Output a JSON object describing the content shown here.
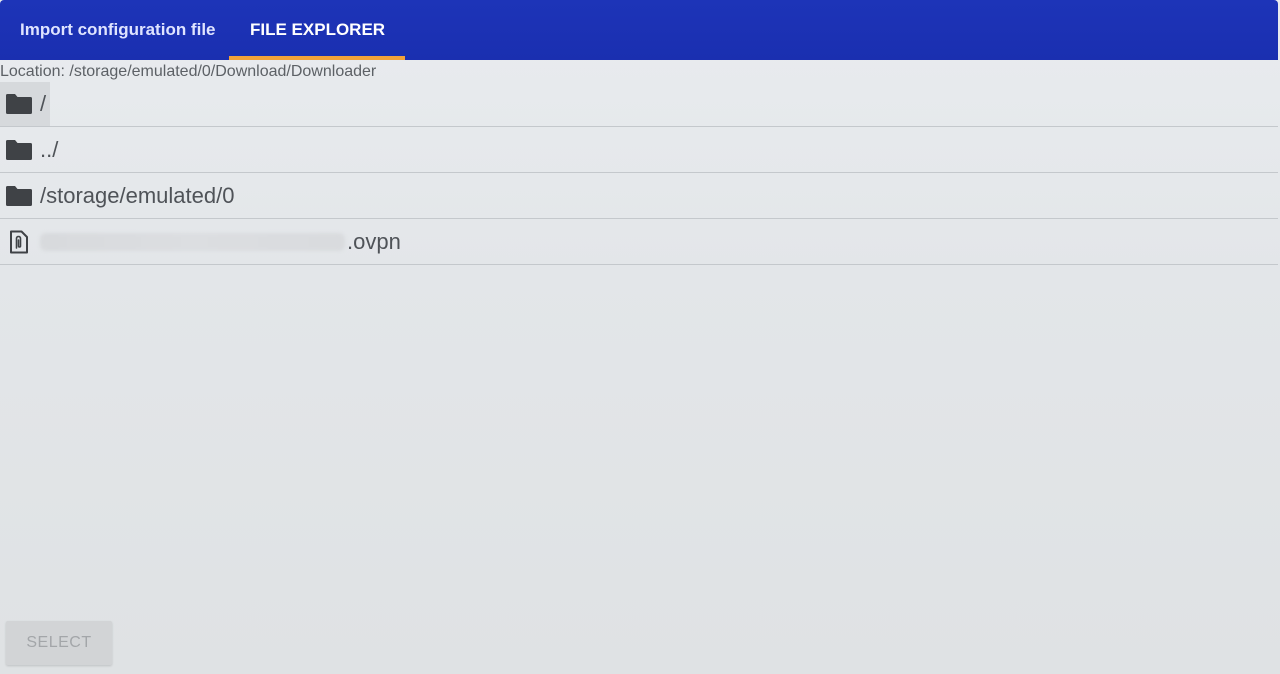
{
  "tabs": {
    "import_label": "Import configuration file",
    "explorer_label": "FILE EXPLORER",
    "indicator_color": "#f2a23a",
    "bar_color": "#1d34b8"
  },
  "location": {
    "text": "Location: /storage/emulated/0/Download/Downloader"
  },
  "file_list": {
    "items": [
      {
        "label": "/",
        "icon": "folder-icon"
      },
      {
        "label": "../",
        "icon": "folder-icon"
      },
      {
        "label": "/storage/emulated/0",
        "icon": "folder-icon"
      },
      {
        "label": ".ovpn",
        "icon": "file-icon"
      }
    ]
  },
  "actions": {
    "select_label": "SELECT"
  }
}
